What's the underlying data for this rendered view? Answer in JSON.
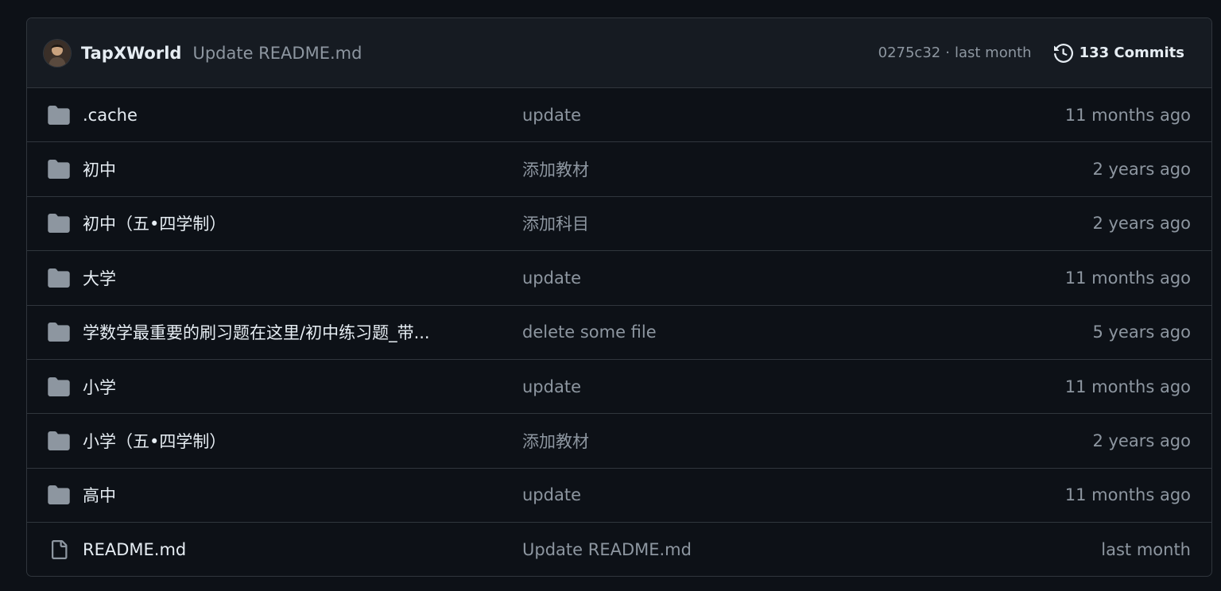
{
  "latest_commit": {
    "author": "TapXWorld",
    "message": "Update README.md",
    "sha": "0275c32",
    "separator": "·",
    "time": "last month",
    "commits_count_label": "133 Commits",
    "icons": {
      "avatar": "user-avatar",
      "history": "history-icon"
    }
  },
  "files": [
    {
      "name": ".cache",
      "type": "folder",
      "message": "update",
      "age": "11 months ago"
    },
    {
      "name": "初中",
      "type": "folder",
      "message": "添加教材",
      "age": "2 years ago"
    },
    {
      "name": "初中（五•四学制）",
      "type": "folder",
      "message": "添加科目",
      "age": "2 years ago"
    },
    {
      "name": "大学",
      "type": "folder",
      "message": "update",
      "age": "11 months ago"
    },
    {
      "name": "学数学最重要的刷习题在这里/初中练习题_带...",
      "type": "folder",
      "message": "delete some file",
      "age": "5 years ago"
    },
    {
      "name": "小学",
      "type": "folder",
      "message": "update",
      "age": "11 months ago"
    },
    {
      "name": "小学（五•四学制）",
      "type": "folder",
      "message": "添加教材",
      "age": "2 years ago"
    },
    {
      "name": "高中",
      "type": "folder",
      "message": "update",
      "age": "11 months ago"
    },
    {
      "name": "README.md",
      "type": "file",
      "message": "Update README.md",
      "age": "last month"
    }
  ],
  "colors": {
    "background": "#0d1117",
    "header_background": "#161b22",
    "border": "#30363d",
    "text_primary": "#e6edf3",
    "text_muted": "#8d96a0",
    "folder_icon": "#8d96a0"
  }
}
